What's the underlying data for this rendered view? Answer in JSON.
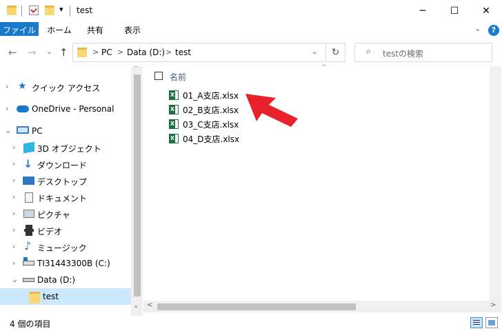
{
  "window": {
    "title": "test",
    "qat_dropdown": "▾",
    "controls": {
      "minimize": "─",
      "maximize": "☐",
      "close": "✕"
    }
  },
  "ribbon": {
    "tabs": [
      {
        "label": "ファイル"
      },
      {
        "label": "ホーム"
      },
      {
        "label": "共有"
      },
      {
        "label": "表示"
      }
    ],
    "expand_glyph": "⌄",
    "help_glyph": "?"
  },
  "nav": {
    "back": "←",
    "forward": "→",
    "recent": "⌄",
    "up": "↑",
    "refresh": "↻"
  },
  "address": {
    "separator": ">",
    "crumbs": [
      "PC",
      "Data (D:)",
      "test"
    ],
    "dropdown_glyph": "⌄"
  },
  "search": {
    "icon": "⌕",
    "placeholder": "testの検索"
  },
  "sidebar": {
    "items": [
      {
        "label": "クイック アクセス",
        "icon": "star-icon",
        "arrow": "›"
      },
      {
        "label": "OneDrive - Personal",
        "icon": "cloud-icon",
        "arrow": "›"
      },
      {
        "label": "PC",
        "icon": "computer-icon",
        "arrow": "⌄"
      },
      {
        "label": "3D オブジェクト",
        "icon": "cube-icon",
        "arrow": "›"
      },
      {
        "label": "ダウンロード",
        "icon": "download-icon",
        "arrow": "›"
      },
      {
        "label": "デスクトップ",
        "icon": "desktop-icon",
        "arrow": "›"
      },
      {
        "label": "ドキュメント",
        "icon": "document-icon",
        "arrow": "›"
      },
      {
        "label": "ピクチャ",
        "icon": "picture-icon",
        "arrow": "›"
      },
      {
        "label": "ビデオ",
        "icon": "video-icon",
        "arrow": "›"
      },
      {
        "label": "ミュージック",
        "icon": "music-icon",
        "arrow": "›"
      },
      {
        "label": "TI31443300B (C:)",
        "icon": "drive-c-icon",
        "arrow": "›"
      },
      {
        "label": "Data (D:)",
        "icon": "drive-icon",
        "arrow": "⌄"
      },
      {
        "label": "test",
        "icon": "folder-icon",
        "arrow": ""
      }
    ],
    "scroll_up": "⌃",
    "scroll_down": "⌄"
  },
  "content": {
    "column_name": "名前",
    "sort_caret": "^",
    "files": [
      {
        "name": "01_A支店.xlsx"
      },
      {
        "name": "02_B支店.xlsx"
      },
      {
        "name": "03_C支店.xlsx"
      },
      {
        "name": "04_D支店.xlsx"
      }
    ],
    "scroll_left": "<",
    "scroll_right": ">"
  },
  "status": {
    "item_count": "4 個の項目"
  },
  "colors": {
    "accent": "#1979ca",
    "selection": "#cce8ff",
    "annotation_arrow": "#e8212b",
    "excel_green": "#1d6f42",
    "folder": "#f8d775"
  }
}
